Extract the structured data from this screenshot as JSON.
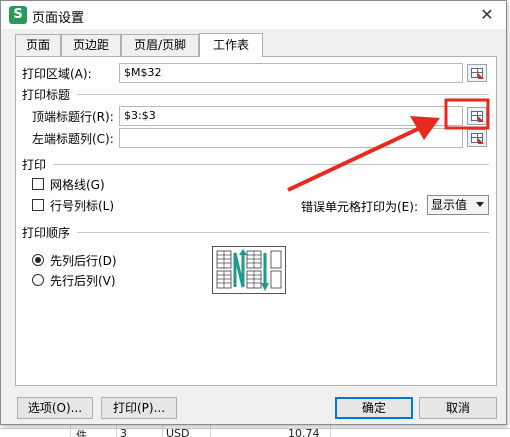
{
  "dialog": {
    "title": "页面设置",
    "app_icon_letter": "S",
    "close_glyph": "✕"
  },
  "tabs": [
    {
      "label": "页面",
      "active": false
    },
    {
      "label": "页边距",
      "active": false
    },
    {
      "label": "页眉/页脚",
      "active": false
    },
    {
      "label": "工作表",
      "active": true
    }
  ],
  "print_area": {
    "label": "打印区域(A):",
    "value": "$M$32"
  },
  "print_titles": {
    "section_label": "打印标题",
    "top_rows": {
      "label": "顶端标题行(R):",
      "value": "$3:$3"
    },
    "left_cols": {
      "label": "左端标题列(C):",
      "value": ""
    }
  },
  "print": {
    "section_label": "打印",
    "gridlines": {
      "label": "网格线(G)",
      "checked": false
    },
    "headings": {
      "label": "行号列标(L)",
      "checked": false
    },
    "errors_label": "错误单元格打印为(E):",
    "errors_value": "显示值"
  },
  "order": {
    "section_label": "打印顺序",
    "down_then_over": {
      "label": "先列后行(D)",
      "checked": true
    },
    "over_then_down": {
      "label": "先行后列(V)",
      "checked": false
    }
  },
  "buttons": {
    "options": "选项(O)...",
    "print": "打印(P)...",
    "ok": "确定",
    "cancel": "取消"
  },
  "sheet": {
    "cell_a": "件",
    "cell_b": "3",
    "cell_c": "USD",
    "cell_d": "10.74"
  },
  "colors": {
    "annotation_arrow": "#e8291c",
    "annotation_box": "#e8291c",
    "order_arrow": "#1f9a8a"
  }
}
